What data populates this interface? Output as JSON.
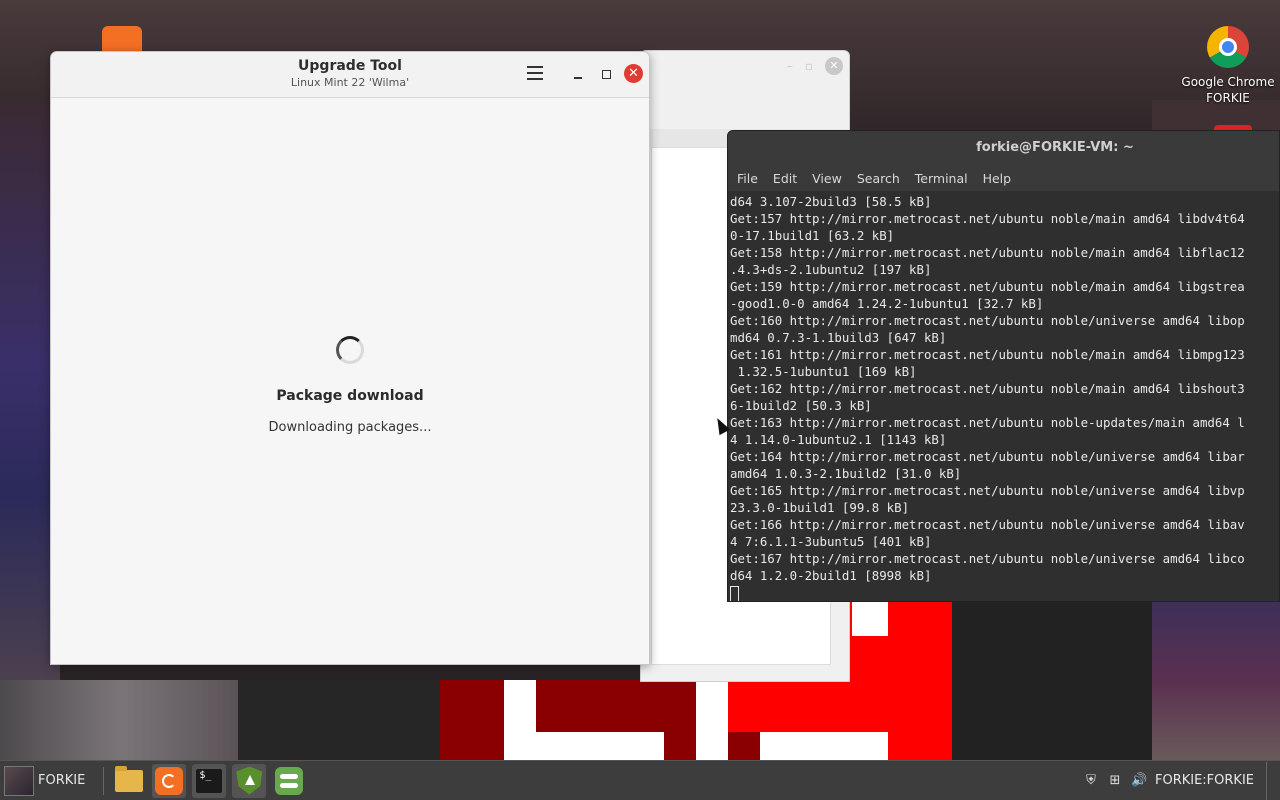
{
  "desktop": {
    "icons": [
      {
        "label_line1": "Google Chrome",
        "label_line2": "FORKIE",
        "icon": "chrome-icon"
      }
    ]
  },
  "upgrade_tool": {
    "title": "Upgrade Tool",
    "subtitle": "Linux Mint 22 'Wilma'",
    "menu_icon": "hamburger-menu-icon",
    "close_glyph": "✕",
    "status_title": "Package download",
    "status_text": "Downloading packages..."
  },
  "terminal": {
    "title": "forkie@FORKIE-VM: ~",
    "menu": [
      "File",
      "Edit",
      "View",
      "Search",
      "Terminal",
      "Help"
    ],
    "lines": [
      "d64 3.107-2build3 [58.5 kB]",
      "Get:157 http://mirror.metrocast.net/ubuntu noble/main amd64 libdv4t64",
      "0-17.1build1 [63.2 kB]",
      "Get:158 http://mirror.metrocast.net/ubuntu noble/main amd64 libflac12",
      ".4.3+ds-2.1ubuntu2 [197 kB]",
      "Get:159 http://mirror.metrocast.net/ubuntu noble/main amd64 libgstrea",
      "-good1.0-0 amd64 1.24.2-1ubuntu1 [32.7 kB]",
      "Get:160 http://mirror.metrocast.net/ubuntu noble/universe amd64 libop",
      "md64 0.7.3-1.1build3 [647 kB]",
      "Get:161 http://mirror.metrocast.net/ubuntu noble/main amd64 libmpg123",
      " 1.32.5-1ubuntu1 [169 kB]",
      "Get:162 http://mirror.metrocast.net/ubuntu noble/main amd64 libshout3",
      "6-1build2 [50.3 kB]",
      "Get:163 http://mirror.metrocast.net/ubuntu noble-updates/main amd64 l",
      "4 1.14.0-1ubuntu2.1 [1143 kB]",
      "Get:164 http://mirror.metrocast.net/ubuntu noble/universe amd64 libar",
      "amd64 1.0.3-2.1build2 [31.0 kB]",
      "Get:165 http://mirror.metrocast.net/ubuntu noble/universe amd64 libvp",
      "23.3.0-1build1 [99.8 kB]",
      "Get:166 http://mirror.metrocast.net/ubuntu noble/universe amd64 libav",
      "4 7:6.1.1-3ubuntu5 [401 kB]",
      "Get:167 http://mirror.metrocast.net/ubuntu noble/universe amd64 libco",
      "d64 1.2.0-2build1 [8998 kB]"
    ]
  },
  "taskbar": {
    "menu_label": "FORKIE",
    "launchers": [
      {
        "name": "files-icon",
        "active": false
      },
      {
        "name": "update-manager-icon",
        "active": true
      },
      {
        "name": "terminal-icon",
        "active": true
      },
      {
        "name": "upgrade-shield-icon",
        "active": true
      },
      {
        "name": "settings-toggle-icon",
        "active": false
      }
    ],
    "terminal_glyph": "$_",
    "tray": {
      "shield_glyph": "⛨",
      "network_glyph": "⊞",
      "volume_glyph": "🔊",
      "user": "FORKIE:FORKIE"
    }
  },
  "colors": {
    "close_red": "#e03c31",
    "terminal_bg": "#2f2f2f",
    "taskbar_bg": "#3d3d3d",
    "wallpaper_red": "#ff0000"
  }
}
